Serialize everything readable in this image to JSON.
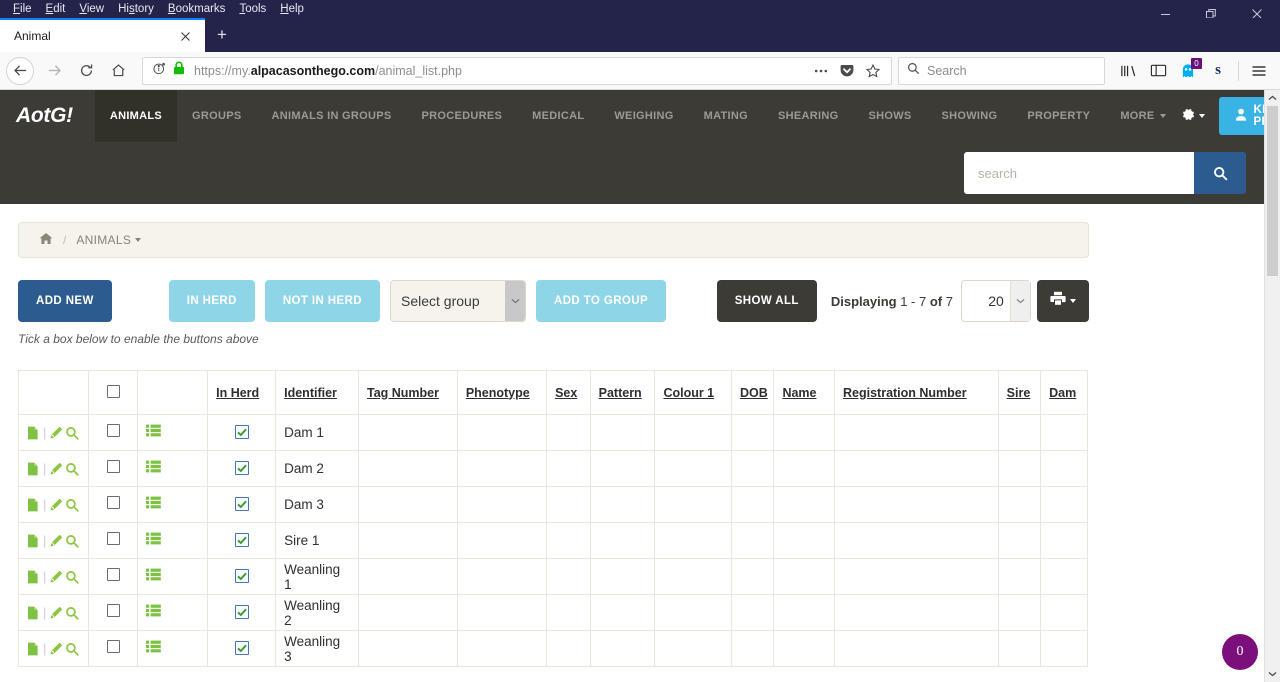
{
  "browser": {
    "menus": [
      "File",
      "Edit",
      "View",
      "History",
      "Bookmarks",
      "Tools",
      "Help"
    ],
    "window_controls": [
      "minimize",
      "restore",
      "close"
    ],
    "tab": {
      "title": "Animal",
      "close_label": "×"
    },
    "new_tab_label": "+",
    "url": {
      "scheme": "https://",
      "subdomain": "my.",
      "domain": "alpacasonthego.com",
      "path": "/animal_list.php",
      "full": "https://my.alpacasonthego.com/animal_list.php"
    },
    "search": {
      "placeholder": "Search",
      "value": ""
    },
    "toolbar_icons": [
      "page-actions-icon",
      "pocket-icon",
      "bookmark-star-icon",
      "library-icon",
      "sidebar-icon",
      "ghostery-icon",
      "evernote-icon",
      "hamburger-menu-icon"
    ],
    "ghostery_badge": "0"
  },
  "app": {
    "brand": "AotG!",
    "nav_items": [
      {
        "label": "ANIMALS",
        "active": true
      },
      {
        "label": "GROUPS",
        "active": false
      },
      {
        "label": "ANIMALS IN GROUPS",
        "active": false
      },
      {
        "label": "PROCEDURES",
        "active": false
      },
      {
        "label": "MEDICAL",
        "active": false
      },
      {
        "label": "WEIGHING",
        "active": false
      },
      {
        "label": "MATING",
        "active": false
      },
      {
        "label": "SHEARING",
        "active": false
      },
      {
        "label": "SHOWS",
        "active": false
      },
      {
        "label": "SHOWING",
        "active": false
      },
      {
        "label": "PROPERTY",
        "active": false
      },
      {
        "label": "MORE",
        "active": false,
        "caret": true
      }
    ],
    "settings_label": "",
    "user": {
      "name": "KRISTI PROHM"
    },
    "site_search": {
      "placeholder": "search",
      "value": ""
    },
    "breadcrumb": {
      "home_icon": "home-icon",
      "separator": "/",
      "current": "ANIMALS"
    },
    "accent_blue": "#39b3e3",
    "primary_blue": "#2c5c8f",
    "dark": "#3c3b35",
    "green": "#7dc242",
    "badge_purple": "#7b0f7b"
  },
  "toolbar": {
    "add_new": "ADD NEW",
    "in_herd": "IN HERD",
    "not_in_herd": "NOT IN HERD",
    "select_group": "Select group",
    "add_to_group": "ADD TO GROUP",
    "show_all": "SHOW ALL",
    "displaying_label": "Displaying",
    "displaying_range": "1 - 7",
    "displaying_of": "of",
    "displaying_total": "7",
    "per_page": "20",
    "print_label": "print-icon",
    "hint": "Tick a box below to enable the buttons above"
  },
  "table": {
    "headers": [
      "",
      "",
      "",
      "In Herd",
      "Identifier",
      "Tag Number",
      "Phenotype",
      "Sex",
      "Pattern",
      "Colour 1",
      "DOB",
      "Name",
      "Registration Number",
      "Sire",
      "Dam"
    ],
    "select_all_checkbox": false,
    "rows": [
      {
        "in_herd": true,
        "identifier": "Dam 1",
        "tag_number": "",
        "phenotype": "",
        "sex": "",
        "pattern": "",
        "colour1": "",
        "dob": "",
        "name": "",
        "registration_number": "",
        "sire": "",
        "dam": "",
        "selected": false
      },
      {
        "in_herd": true,
        "identifier": "Dam 2",
        "tag_number": "",
        "phenotype": "",
        "sex": "",
        "pattern": "",
        "colour1": "",
        "dob": "",
        "name": "",
        "registration_number": "",
        "sire": "",
        "dam": "",
        "selected": false
      },
      {
        "in_herd": true,
        "identifier": "Dam 3",
        "tag_number": "",
        "phenotype": "",
        "sex": "",
        "pattern": "",
        "colour1": "",
        "dob": "",
        "name": "",
        "registration_number": "",
        "sire": "",
        "dam": "",
        "selected": false
      },
      {
        "in_herd": true,
        "identifier": "Sire 1",
        "tag_number": "",
        "phenotype": "",
        "sex": "",
        "pattern": "",
        "colour1": "",
        "dob": "",
        "name": "",
        "registration_number": "",
        "sire": "",
        "dam": "",
        "selected": false
      },
      {
        "in_herd": true,
        "identifier": "Weanling 1",
        "tag_number": "",
        "phenotype": "",
        "sex": "",
        "pattern": "",
        "colour1": "",
        "dob": "",
        "name": "",
        "registration_number": "",
        "sire": "",
        "dam": "",
        "selected": false
      },
      {
        "in_herd": true,
        "identifier": "Weanling 2",
        "tag_number": "",
        "phenotype": "",
        "sex": "",
        "pattern": "",
        "colour1": "",
        "dob": "",
        "name": "",
        "registration_number": "",
        "sire": "",
        "dam": "",
        "selected": false
      },
      {
        "in_herd": true,
        "identifier": "Weanling 3",
        "tag_number": "",
        "phenotype": "",
        "sex": "",
        "pattern": "",
        "colour1": "",
        "dob": "",
        "name": "",
        "registration_number": "",
        "sire": "",
        "dam": "",
        "selected": false
      }
    ],
    "row_action_icons": [
      "copy-icon",
      "edit-pencil-icon",
      "view-magnifier-icon",
      "list-details-icon"
    ]
  },
  "floating": {
    "counter": "0"
  }
}
